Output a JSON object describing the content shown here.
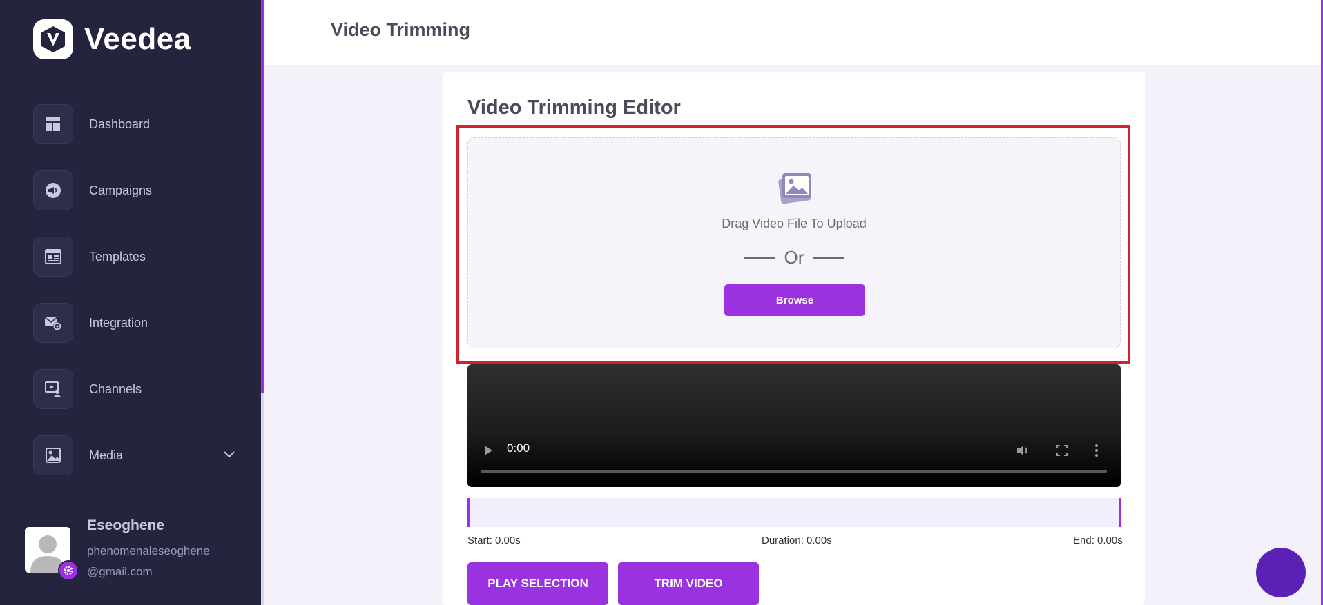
{
  "brand": {
    "name": "Veedea"
  },
  "sidebar": {
    "items": [
      {
        "label": "Dashboard",
        "icon": "dashboard-icon"
      },
      {
        "label": "Campaigns",
        "icon": "megaphone-icon"
      },
      {
        "label": "Templates",
        "icon": "template-icon"
      },
      {
        "label": "Integration",
        "icon": "mail-gear-icon"
      },
      {
        "label": "Channels",
        "icon": "channel-icon"
      },
      {
        "label": "Media",
        "icon": "image-icon"
      }
    ]
  },
  "profile": {
    "name": "Eseoghene",
    "email_line1": "phenomenaleseoghene",
    "email_line2": "@gmail.com"
  },
  "header": {
    "title": "Video Trimming"
  },
  "editor": {
    "title": "Video Trimming Editor",
    "drag_text": "Drag Video File To Upload",
    "or_text": "Or",
    "browse_label": "Browse"
  },
  "video": {
    "time": "0:00"
  },
  "trim": {
    "start": "Start: 0.00s",
    "duration": "Duration: 0.00s",
    "end": "End: 0.00s"
  },
  "actions": {
    "play_selection": "PLAY SELECTION",
    "trim_video": "TRIM VIDEO"
  },
  "colors": {
    "sidebar_bg": "#25243f",
    "accent": "#9b32e0",
    "highlight": "#d41f2e",
    "chat": "#5b21b6"
  }
}
